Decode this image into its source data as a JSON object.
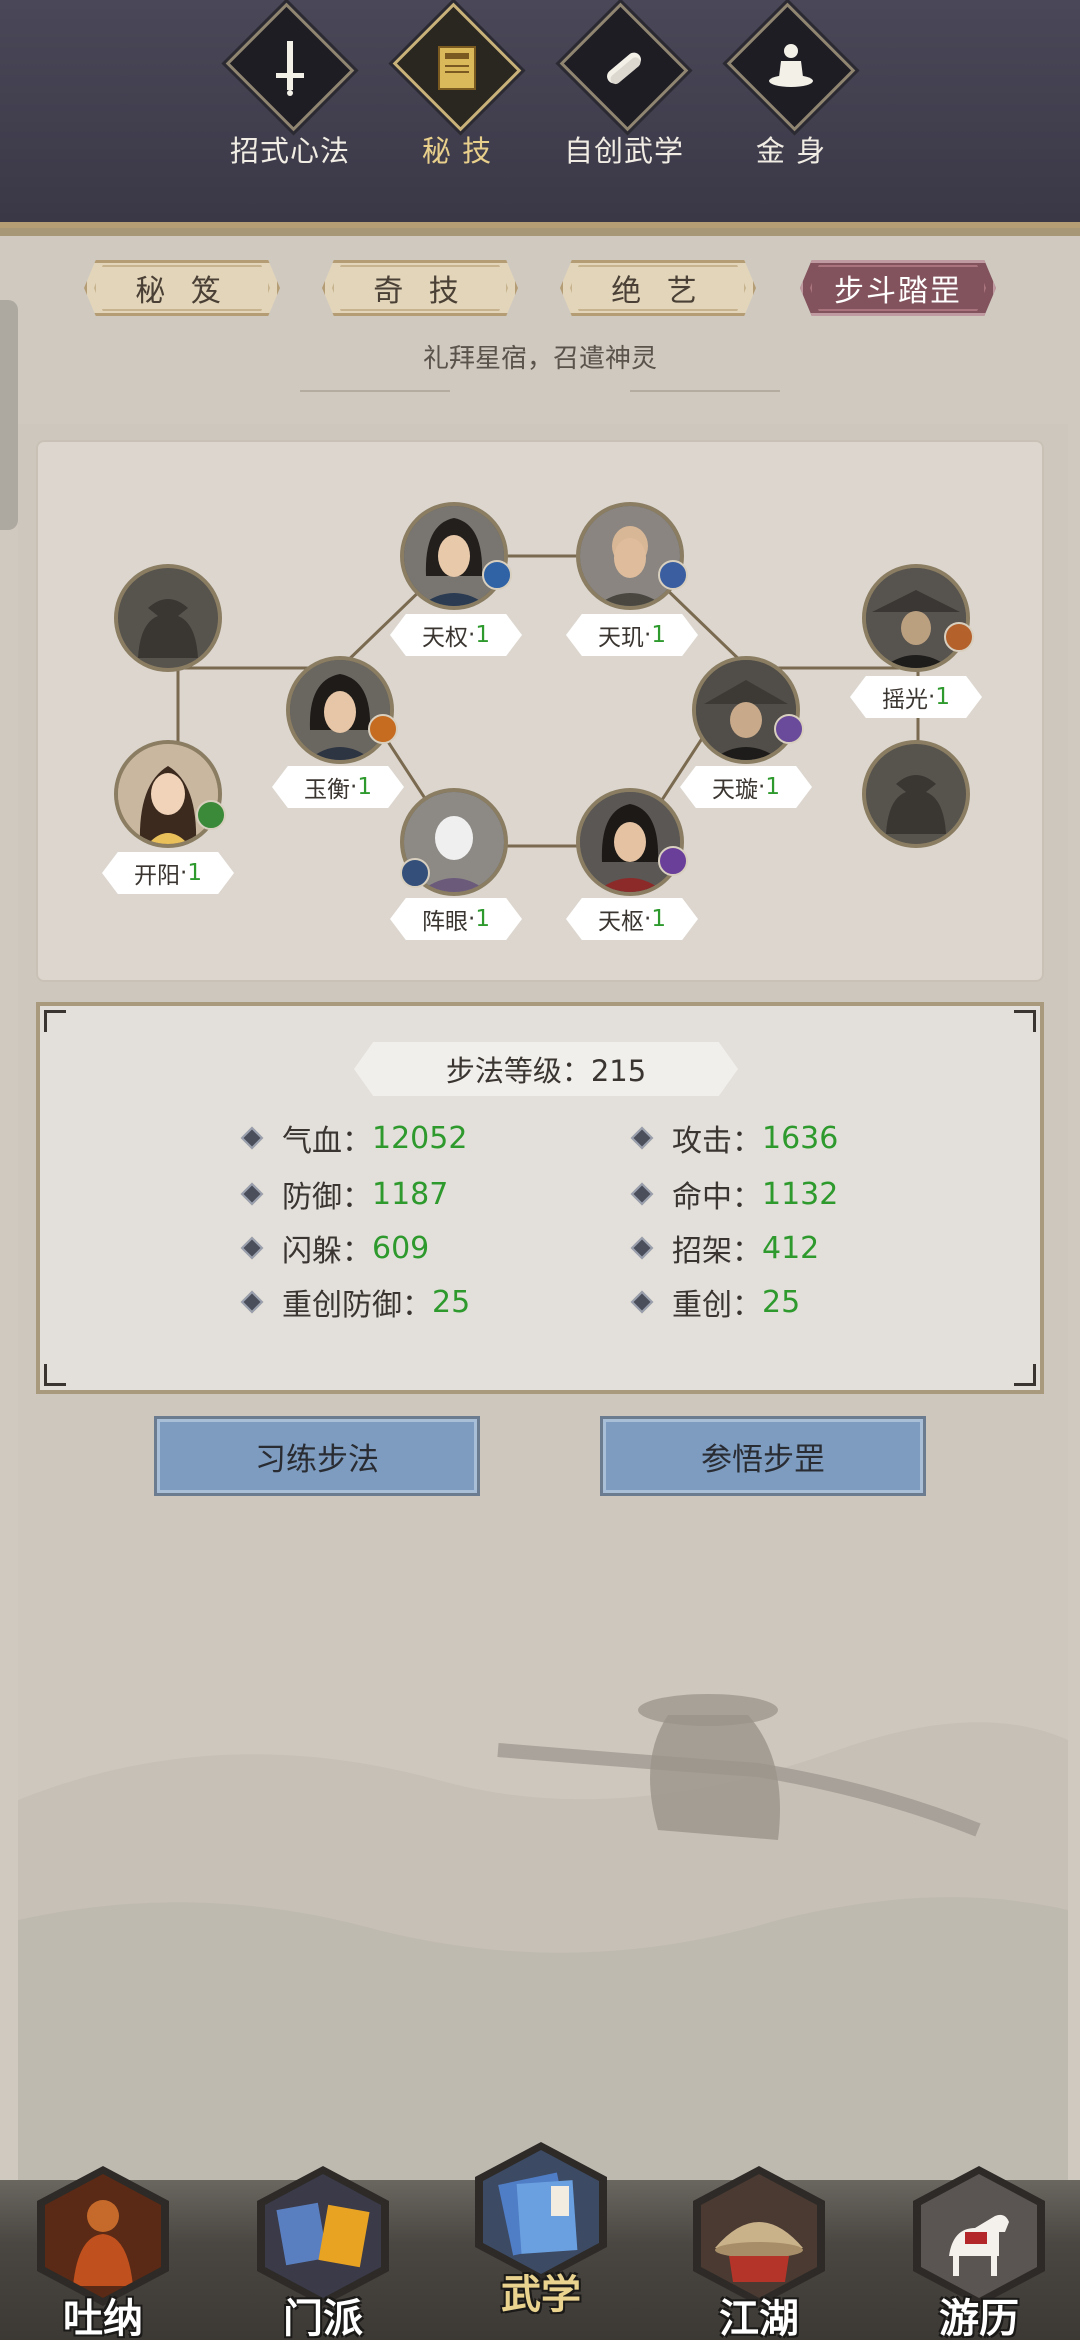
{
  "top_tabs": [
    {
      "label": "招式心法",
      "icon": "sword-icon"
    },
    {
      "label": "秘 技",
      "icon": "scroll-book-icon",
      "active": true
    },
    {
      "label": "自创武学",
      "icon": "scrolls-icon"
    },
    {
      "label": "金 身",
      "icon": "meditation-icon"
    }
  ],
  "sub_tabs": [
    {
      "label": "秘 笈"
    },
    {
      "label": "奇 技"
    },
    {
      "label": "绝 艺"
    },
    {
      "label": "步斗踏罡",
      "active": true
    }
  ],
  "subtitle": "礼拜星宿，召遣神灵",
  "constellation": {
    "nodes": [
      {
        "name": "天权",
        "level": "1"
      },
      {
        "name": "天玑",
        "level": "1"
      },
      {
        "name": "玉衡",
        "level": "1"
      },
      {
        "name": "天璇",
        "level": "1"
      },
      {
        "name": "摇光",
        "level": "1"
      },
      {
        "name": "开阳",
        "level": "1"
      },
      {
        "name": "阵眼",
        "level": "1"
      },
      {
        "name": "天枢",
        "level": "1"
      }
    ],
    "level_sep": "·"
  },
  "stats": {
    "level_label": "步法等级：215",
    "items": [
      {
        "label": "气血：",
        "value": "12052"
      },
      {
        "label": "攻击：",
        "value": "1636"
      },
      {
        "label": "防御：",
        "value": "1187"
      },
      {
        "label": "命中：",
        "value": "1132"
      },
      {
        "label": "闪躲：",
        "value": "609"
      },
      {
        "label": "招架：",
        "value": "412"
      },
      {
        "label": "重创防御：",
        "value": "25"
      },
      {
        "label": "重创：",
        "value": "25"
      }
    ]
  },
  "actions": {
    "practice": "习练步法",
    "comprehend": "参悟步罡"
  },
  "bottom_nav": [
    {
      "label": "吐纳",
      "icon": "monk-icon"
    },
    {
      "label": "门派",
      "icon": "sect-banner-icon"
    },
    {
      "label": "武学",
      "icon": "martial-book-icon",
      "active": true
    },
    {
      "label": "江湖",
      "icon": "straw-hat-icon"
    },
    {
      "label": "游历",
      "icon": "horse-icon"
    }
  ],
  "colors": {
    "accent_gold": "#e8cf8b",
    "active_tab": "#82535c",
    "level_green": "#2e9a2e",
    "button_blue": "#7d9cbf"
  }
}
